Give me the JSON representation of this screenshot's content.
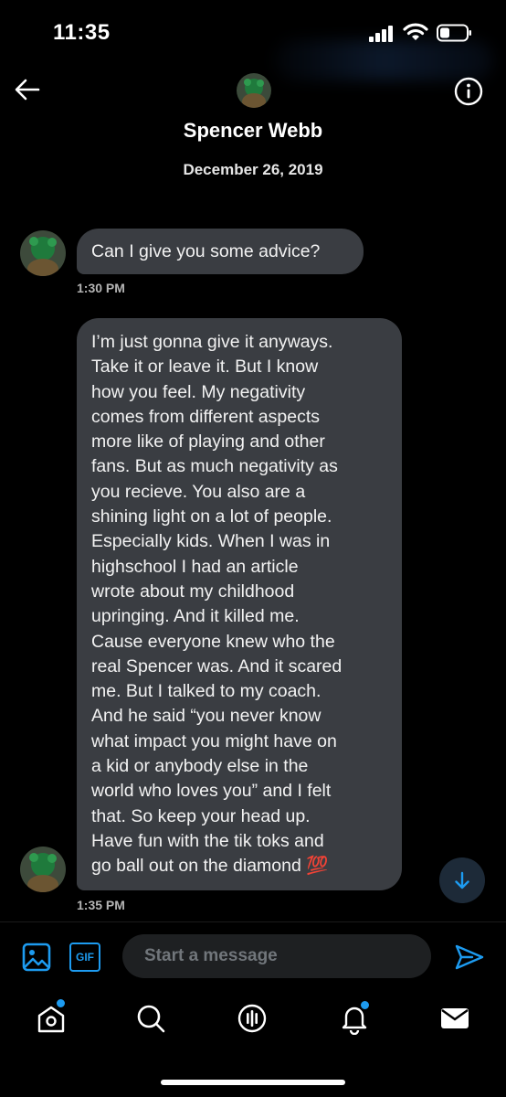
{
  "status_bar": {
    "time": "11:35"
  },
  "header": {
    "contact_name": "Spencer Webb",
    "date": "December 26, 2019"
  },
  "messages": [
    {
      "text_lines": [
        "Can I give you some advice?"
      ],
      "time": "1:30 PM"
    },
    {
      "text_lines": [
        "I’m just gonna give it anyways.",
        "Take it or leave it. But I know",
        "how you feel. My negativity",
        "comes from different aspects",
        "more like of playing and other",
        "fans. But as much negativity as",
        "you recieve. You also are a",
        "shining light on a lot of people.",
        "Especially kids. When I was in",
        "highschool I had an article",
        "wrote about my childhood",
        "upringing. And it killed me.",
        "Cause everyone knew who the",
        "real Spencer was. And it scared",
        "me. But I talked to my coach.",
        "And he said “you never know",
        "what impact you might have on",
        "a kid or anybody else in the",
        "world who loves you” and I felt",
        "that. So keep your head up.",
        "Have fun with the tik toks and",
        "go ball out on the diamond 💯"
      ],
      "time": "1:35 PM"
    }
  ],
  "composer": {
    "gif_label": "GIF",
    "placeholder": "Start a message"
  },
  "bottom_nav": {
    "items": [
      "home-icon",
      "search-icon",
      "spaces-icon",
      "notifications-icon",
      "messages-icon"
    ]
  },
  "colors": {
    "accent": "#1d9bf0",
    "bubble": "#3a3d42",
    "background": "#000000"
  }
}
